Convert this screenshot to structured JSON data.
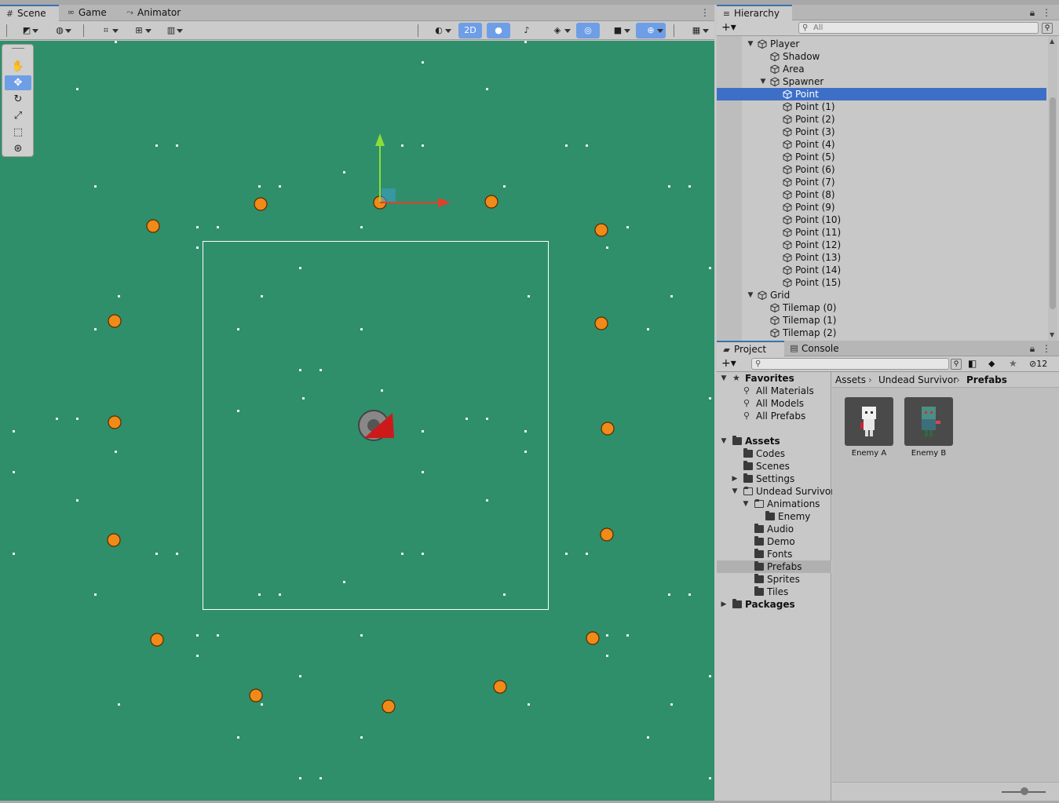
{
  "scene_panel": {
    "tabs": [
      {
        "label": "Scene",
        "icon": "grid-icon"
      },
      {
        "label": "Game",
        "icon": "gamepad-icon"
      },
      {
        "label": "Animator",
        "icon": "animator-icon"
      }
    ],
    "toolbar": {
      "mode_2d_label": "2D"
    }
  },
  "hierarchy": {
    "tab_label": "Hierarchy",
    "search_placeholder": "All",
    "rows": [
      {
        "label": "Player",
        "indent": 0,
        "arrow": "down"
      },
      {
        "label": "Shadow",
        "indent": 1,
        "arrow": ""
      },
      {
        "label": "Area",
        "indent": 1,
        "arrow": ""
      },
      {
        "label": "Spawner",
        "indent": 1,
        "arrow": "down"
      },
      {
        "label": "Point",
        "indent": 2,
        "arrow": "",
        "selected": true
      },
      {
        "label": "Point (1)",
        "indent": 2,
        "arrow": ""
      },
      {
        "label": "Point (2)",
        "indent": 2,
        "arrow": ""
      },
      {
        "label": "Point (3)",
        "indent": 2,
        "arrow": ""
      },
      {
        "label": "Point (4)",
        "indent": 2,
        "arrow": ""
      },
      {
        "label": "Point (5)",
        "indent": 2,
        "arrow": ""
      },
      {
        "label": "Point (6)",
        "indent": 2,
        "arrow": ""
      },
      {
        "label": "Point (7)",
        "indent": 2,
        "arrow": ""
      },
      {
        "label": "Point (8)",
        "indent": 2,
        "arrow": ""
      },
      {
        "label": "Point (9)",
        "indent": 2,
        "arrow": ""
      },
      {
        "label": "Point (10)",
        "indent": 2,
        "arrow": ""
      },
      {
        "label": "Point (11)",
        "indent": 2,
        "arrow": ""
      },
      {
        "label": "Point (12)",
        "indent": 2,
        "arrow": ""
      },
      {
        "label": "Point (13)",
        "indent": 2,
        "arrow": ""
      },
      {
        "label": "Point (14)",
        "indent": 2,
        "arrow": ""
      },
      {
        "label": "Point (15)",
        "indent": 2,
        "arrow": ""
      },
      {
        "label": "Grid",
        "indent": 0,
        "arrow": "down"
      },
      {
        "label": "Tilemap (0)",
        "indent": 1,
        "arrow": ""
      },
      {
        "label": "Tilemap (1)",
        "indent": 1,
        "arrow": ""
      },
      {
        "label": "Tilemap (2)",
        "indent": 1,
        "arrow": ""
      }
    ]
  },
  "project": {
    "tabs": [
      {
        "label": "Project",
        "icon": "folder-icon"
      },
      {
        "label": "Console",
        "icon": "console-icon"
      }
    ],
    "hidden_count": "12",
    "tree": [
      {
        "label": "Favorites",
        "level": 0,
        "arrow": "down",
        "bold": true,
        "icon": "star"
      },
      {
        "label": "All Materials",
        "level": 1,
        "arrow": "",
        "icon": "search"
      },
      {
        "label": "All Models",
        "level": 1,
        "arrow": "",
        "icon": "search"
      },
      {
        "label": "All Prefabs",
        "level": 1,
        "arrow": "",
        "icon": "search"
      },
      {
        "label": "",
        "level": 0,
        "arrow": "",
        "icon": "none"
      },
      {
        "label": "Assets",
        "level": 0,
        "arrow": "down",
        "bold": true,
        "icon": "folder"
      },
      {
        "label": "Codes",
        "level": 1,
        "arrow": "",
        "icon": "folder"
      },
      {
        "label": "Scenes",
        "level": 1,
        "arrow": "",
        "icon": "folder"
      },
      {
        "label": "Settings",
        "level": 1,
        "arrow": "right",
        "icon": "folder"
      },
      {
        "label": "Undead Survivor",
        "level": 1,
        "arrow": "down",
        "icon": "folder-open"
      },
      {
        "label": "Animations",
        "level": 2,
        "arrow": "down",
        "icon": "folder-open"
      },
      {
        "label": "Enemy",
        "level": 3,
        "arrow": "",
        "icon": "folder"
      },
      {
        "label": "Audio",
        "level": 2,
        "arrow": "",
        "icon": "folder"
      },
      {
        "label": "Demo",
        "level": 2,
        "arrow": "",
        "icon": "folder"
      },
      {
        "label": "Fonts",
        "level": 2,
        "arrow": "",
        "icon": "folder"
      },
      {
        "label": "Prefabs",
        "level": 2,
        "arrow": "",
        "icon": "folder",
        "selected": true
      },
      {
        "label": "Sprites",
        "level": 2,
        "arrow": "",
        "icon": "folder"
      },
      {
        "label": "Tiles",
        "level": 2,
        "arrow": "",
        "icon": "folder"
      },
      {
        "label": "Packages",
        "level": 0,
        "arrow": "right",
        "bold": true,
        "icon": "folder"
      }
    ],
    "breadcrumb": [
      "Assets",
      "Undead Survivor",
      "Prefabs"
    ],
    "assets": [
      {
        "label": "Enemy A",
        "sprite": "skeleton"
      },
      {
        "label": "Enemy B",
        "sprite": "zombie"
      }
    ]
  },
  "colors": {
    "grass": "#2f8f6a",
    "selection": "#3d6fc7",
    "spawn_point": "#f08a18",
    "accent_tool": "#6e9ee6"
  }
}
